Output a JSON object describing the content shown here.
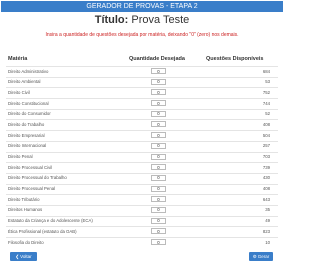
{
  "header": {
    "title": "GERADOR DE PROVAS - ETAPA 2"
  },
  "page": {
    "title_prefix": "Título:",
    "title_value": "Prova Teste",
    "instruction": "Insira a quantidade de questões desejada por matéria, deixando \"0\" (zero) nos demais."
  },
  "table": {
    "headers": {
      "materia": "Matéria",
      "quantidade": "Quantidade Desejada",
      "disponiveis": "Questões Disponíveis"
    },
    "rows": [
      {
        "materia": "Direito Administrativo",
        "quantidade": "0",
        "disponiveis": "684"
      },
      {
        "materia": "Direito Ambiental",
        "quantidade": "0",
        "disponiveis": "53"
      },
      {
        "materia": "Direito Civil",
        "quantidade": "0",
        "disponiveis": "752"
      },
      {
        "materia": "Direito Constitucional",
        "quantidade": "0",
        "disponiveis": "744"
      },
      {
        "materia": "Direito do Consumidor",
        "quantidade": "0",
        "disponiveis": "52"
      },
      {
        "materia": "Direito do Trabalho",
        "quantidade": "0",
        "disponiveis": "408"
      },
      {
        "materia": "Direito Empresarial",
        "quantidade": "0",
        "disponiveis": "504"
      },
      {
        "materia": "Direito Internacional",
        "quantidade": "0",
        "disponiveis": "257"
      },
      {
        "materia": "Direito Penal",
        "quantidade": "0",
        "disponiveis": "703"
      },
      {
        "materia": "Direito Processual Civil",
        "quantidade": "0",
        "disponiveis": "739"
      },
      {
        "materia": "Direito Processual do Trabalho",
        "quantidade": "0",
        "disponiveis": "430"
      },
      {
        "materia": "Direito Processual Penal",
        "quantidade": "0",
        "disponiveis": "408"
      },
      {
        "materia": "Direito Tributário",
        "quantidade": "0",
        "disponiveis": "643"
      },
      {
        "materia": "Direitos Humanos",
        "quantidade": "0",
        "disponiveis": "35"
      },
      {
        "materia": "Estatuto da Criança e do Adolescente (ECA)",
        "quantidade": "0",
        "disponiveis": "49"
      },
      {
        "materia": "Ética Profissional (estatuto da OAB)",
        "quantidade": "0",
        "disponiveis": "823"
      },
      {
        "materia": "Filosofia do Direito",
        "quantidade": "0",
        "disponiveis": "10"
      }
    ]
  },
  "buttons": {
    "back": "Voltar",
    "generate": "Gerar"
  },
  "icons": {
    "back": "arrow-left-icon",
    "generate": "gear-icon"
  },
  "colors": {
    "accent": "#3a7ec9",
    "instruction": "#cc2222"
  }
}
